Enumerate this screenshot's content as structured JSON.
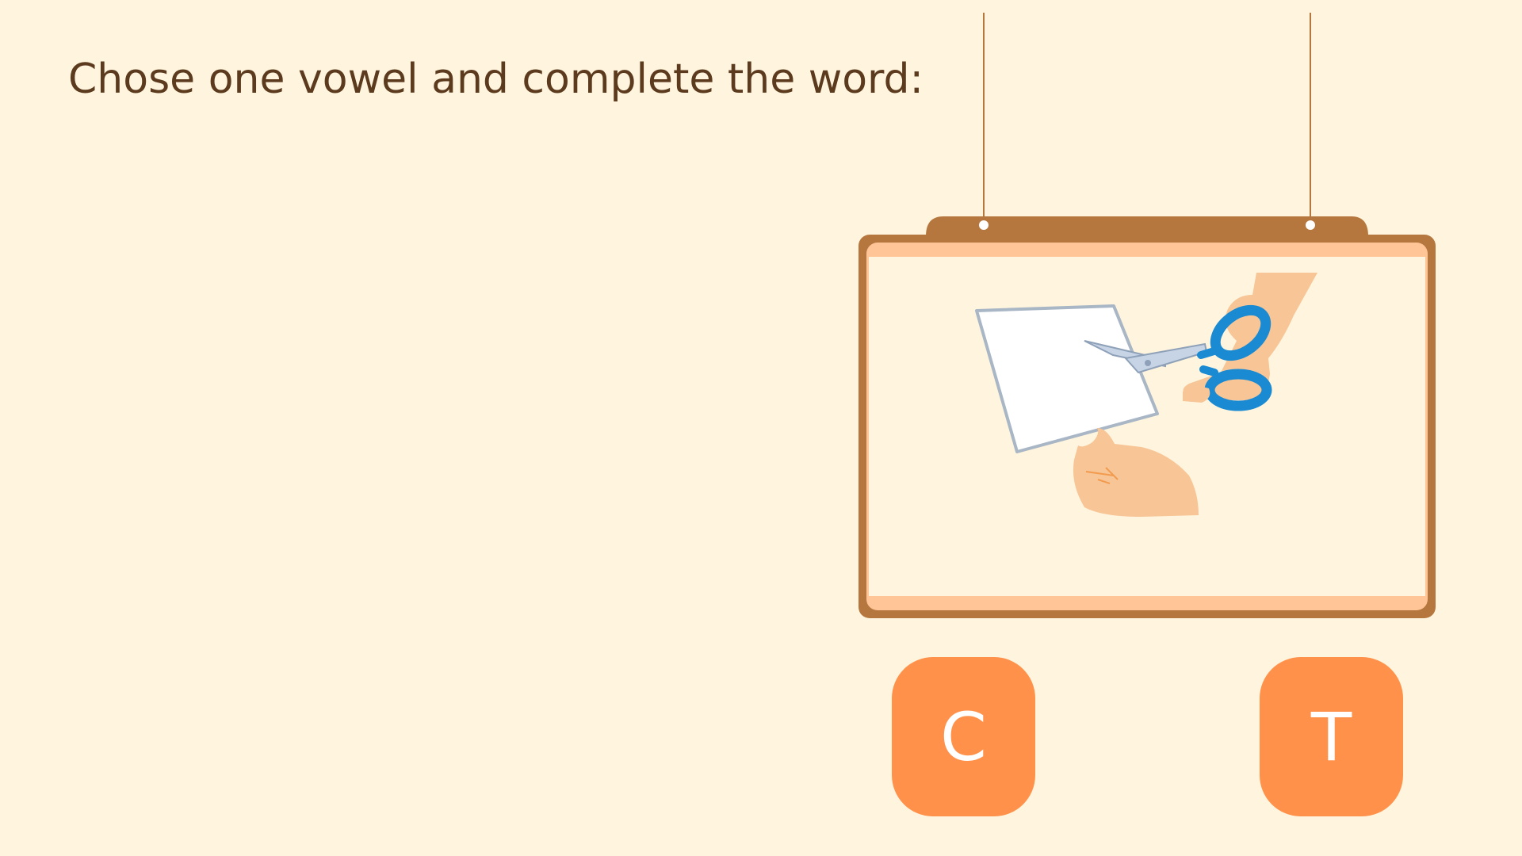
{
  "instruction": "Chose one vowel and complete the word:",
  "board": {
    "picture": "hands-cutting-paper-with-scissors"
  },
  "tiles": [
    {
      "letter": "C"
    },
    {
      "letter": "T"
    }
  ],
  "colors": {
    "background": "#FFF5DE",
    "text": "#5C3A1E",
    "frame": "#B5773E",
    "frame_inner": "#FFC596",
    "tile": "#FF914A",
    "scissors": "#1A8AD3"
  }
}
